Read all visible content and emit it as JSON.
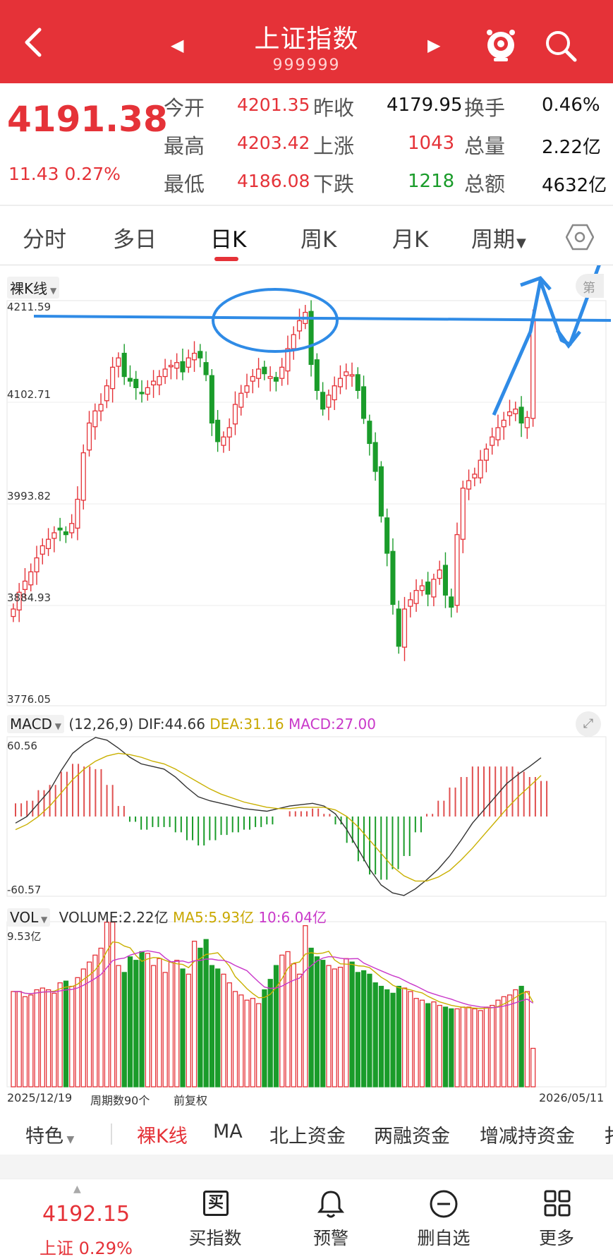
{
  "header": {
    "title": "上证指数",
    "code": "999999",
    "back_icon": "chevron-left-icon",
    "prev_icon": "triangle-left-icon",
    "next_icon": "triangle-right-icon"
  },
  "quote": {
    "price": "4191.38",
    "change": "11.43 0.27%",
    "fields": [
      {
        "label": "今开",
        "value": "4201.35",
        "color": "#e53238"
      },
      {
        "label": "昨收",
        "value": "4179.95",
        "color": "#111111"
      },
      {
        "label": "换手",
        "value": "0.46%",
        "color": "#111111"
      },
      {
        "label": "最高",
        "value": "4203.42",
        "color": "#e53238"
      },
      {
        "label": "上涨",
        "value": "1043",
        "color": "#e53238"
      },
      {
        "label": "总量",
        "value": "2.22亿",
        "color": "#111111"
      },
      {
        "label": "最低",
        "value": "4186.08",
        "color": "#e53238"
      },
      {
        "label": "下跌",
        "value": "1218",
        "color": "#1a9c2a"
      },
      {
        "label": "总额",
        "value": "4632亿",
        "color": "#111111"
      }
    ]
  },
  "tabs": [
    {
      "label": "分时"
    },
    {
      "label": "多日"
    },
    {
      "label": "日K"
    },
    {
      "label": "周K"
    },
    {
      "label": "月K"
    },
    {
      "label": "周期"
    }
  ],
  "kline": {
    "mode_label": "裸K线",
    "right_cut_label": "第"
  },
  "macd": {
    "label": "MACD",
    "params": "(12,26,9)",
    "dif": "DIF:44.66",
    "dea": "DEA:31.16",
    "macd": "MACD:27.00"
  },
  "vol": {
    "label": "VOL",
    "volume": "VOLUME:2.22亿",
    "ma5": "MA5:5.93亿",
    "ma10": "10:6.04亿"
  },
  "footer": {
    "start_date": "2025/12/19",
    "period_count": "周期数90个",
    "adjust": "前复权",
    "end_date": "2026/05/11"
  },
  "bottom_tabs": [
    {
      "label": "特色"
    },
    {
      "label": "裸K线"
    },
    {
      "label": "MA"
    },
    {
      "label": "北上资金"
    },
    {
      "label": "两融资金"
    },
    {
      "label": "增减持资金"
    },
    {
      "label": "扌"
    }
  ],
  "nav": {
    "index_price": "4192.15",
    "index_change": "上证 0.29%",
    "items": [
      {
        "label": "买指数",
        "icon": "buy-icon"
      },
      {
        "label": "预警",
        "icon": "bell-icon"
      },
      {
        "label": "删自选",
        "icon": "minus-circle-icon"
      },
      {
        "label": "更多",
        "icon": "grid-icon"
      }
    ]
  },
  "chart_data": [
    {
      "type": "candlestick",
      "title": "上证指数",
      "ylim": [
        3776.05,
        4211.59
      ],
      "yticks": [
        "4211.59",
        "4102.71",
        "3993.82",
        "3884.93",
        "3776.05"
      ],
      "x_start": "2025/12/19",
      "x_end": "2026/05/11",
      "note": "approximate daily closes read from the chart",
      "closes": [
        3880,
        3898,
        3910,
        3920,
        3935,
        3948,
        3955,
        3962,
        3965,
        3960,
        3972,
        3998,
        4048,
        4080,
        4093,
        4100,
        4120,
        4140,
        4150,
        4130,
        4125,
        4118,
        4112,
        4118,
        4125,
        4130,
        4138,
        4142,
        4145,
        4135,
        4150,
        4155,
        4150,
        4132,
        4080,
        4060,
        4065,
        4075,
        4100,
        4112,
        4120,
        4130,
        4138,
        4133,
        4130,
        4125,
        4140,
        4160,
        4175,
        4190,
        4199,
        4143,
        4115,
        4095,
        4110,
        4120,
        4128,
        4135,
        4132,
        4115,
        4085,
        4058,
        4028,
        3980,
        3940,
        3885,
        3840,
        3880,
        3890,
        3900,
        3905,
        3896,
        3912,
        3922,
        3895,
        3882,
        3960,
        4010,
        4018,
        4025,
        4040,
        4052,
        4065,
        4075,
        4083,
        4092,
        4095,
        4080,
        4086,
        4191
      ]
    },
    {
      "type": "line",
      "title": "MACD",
      "ylim": [
        -60.57,
        60.56
      ],
      "series": [
        {
          "name": "DIF",
          "values": [
            -5,
            0,
            10,
            20,
            35,
            48,
            55,
            60,
            58,
            52,
            45,
            40,
            38,
            36,
            30,
            22,
            15,
            12,
            10,
            8,
            6,
            5,
            4,
            6,
            8,
            9,
            10,
            8,
            2,
            -10,
            -25,
            -40,
            -52,
            -58,
            -60,
            -55,
            -48,
            -40,
            -30,
            -18,
            -5,
            5,
            15,
            25,
            32,
            38,
            44.66
          ]
        },
        {
          "name": "DEA",
          "values": [
            -10,
            -6,
            0,
            8,
            18,
            28,
            36,
            42,
            46,
            48,
            47,
            45,
            42,
            40,
            36,
            31,
            26,
            21,
            17,
            14,
            11,
            9,
            7,
            6,
            6,
            7,
            7,
            7,
            5,
            0,
            -8,
            -18,
            -28,
            -38,
            -45,
            -49,
            -49,
            -46,
            -41,
            -33,
            -24,
            -14,
            -4,
            6,
            15,
            23,
            31.16
          ]
        }
      ],
      "legend": [
        "DIF:44.66",
        "DEA:31.16",
        "MACD:27.00"
      ]
    },
    {
      "type": "bar",
      "title": "VOL",
      "ylim": [
        0,
        9.53
      ],
      "unit": "亿",
      "note": "approximate daily volumes",
      "values": [
        5.5,
        5.5,
        5.2,
        5.3,
        5.6,
        5.7,
        5.6,
        5.4,
        6.0,
        6.1,
        5.8,
        6.3,
        6.8,
        7.2,
        7.6,
        8.0,
        9.5,
        9.5,
        7.0,
        6.6,
        7.5,
        7.3,
        7.8,
        7.7,
        7.0,
        7.4,
        6.6,
        7.2,
        7.3,
        6.8,
        6.5,
        8.4,
        8.0,
        8.5,
        7.0,
        6.8,
        6.5,
        6.0,
        5.5,
        5.3,
        5.0,
        5.1,
        4.8,
        5.6,
        6.2,
        7.0,
        7.6,
        7.8,
        7.1,
        6.5,
        9.3,
        8.0,
        7.5,
        7.3,
        7.0,
        6.8,
        6.9,
        7.4,
        7.2,
        6.6,
        6.7,
        6.5,
        6.0,
        5.8,
        5.6,
        5.4,
        5.8,
        5.7,
        5.5,
        5.1,
        5.0,
        4.8,
        4.9,
        4.7,
        4.6,
        4.5,
        4.5,
        4.6,
        4.6,
        4.5,
        4.4,
        4.6,
        4.7,
        5.0,
        5.2,
        5.3,
        5.6,
        5.8,
        5.5,
        2.22
      ]
    }
  ]
}
